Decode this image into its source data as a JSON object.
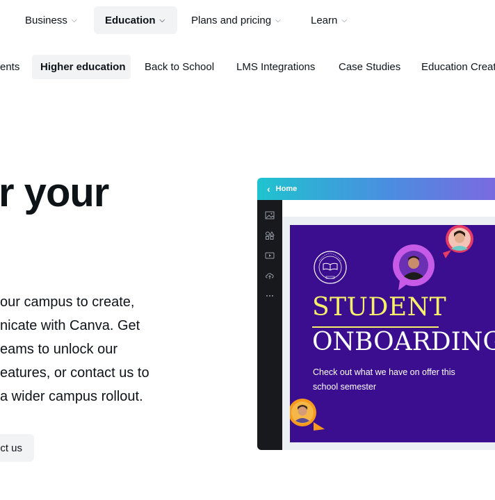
{
  "topnav": [
    {
      "label": "Business"
    },
    {
      "label": "Education",
      "active": true
    },
    {
      "label": "Plans and pricing"
    },
    {
      "label": "Learn"
    }
  ],
  "subnav": [
    {
      "label": "ents"
    },
    {
      "label": "Higher education",
      "active": true
    },
    {
      "label": "Back to School"
    },
    {
      "label": "LMS Integrations"
    },
    {
      "label": "Case Studies"
    },
    {
      "label": "Education Creat"
    }
  ],
  "hero": {
    "title": "r your",
    "lines": [
      "our campus to create,",
      "nicate with Canva. Get",
      "eams to unlock our",
      "eatures, or contact us to",
      "a wider campus rollout."
    ],
    "cta_label": "ct us"
  },
  "mock": {
    "header_label": "Home",
    "poster": {
      "title_1": "STUDENT",
      "title_2": "ONBOARDING",
      "description": "Check out what we have on offer this school semester"
    }
  },
  "colors": {
    "poster_bg": "#3a0e8f",
    "title_yellow": "#f8f06a",
    "nav_active_bg": "#f2f3f5",
    "sidebar_bg": "#17191c"
  }
}
